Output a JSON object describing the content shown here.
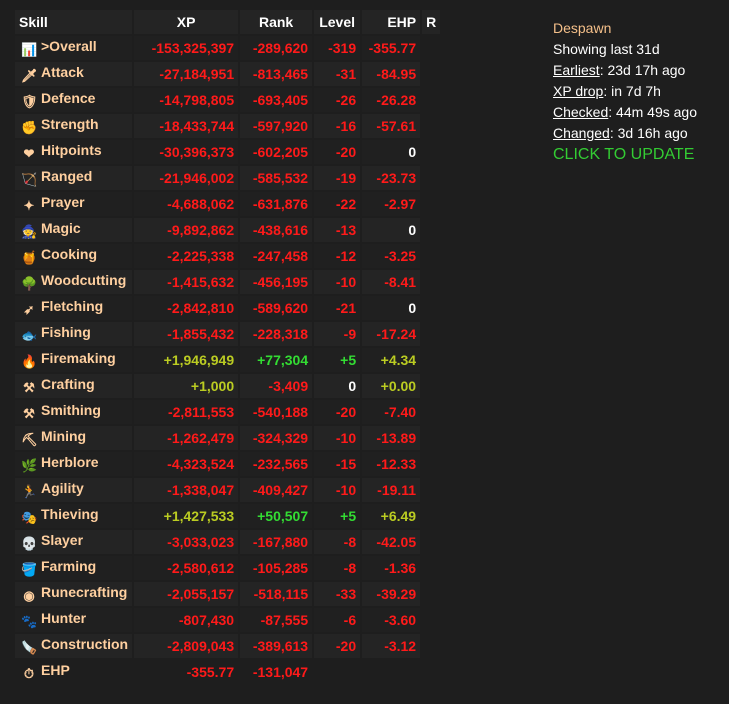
{
  "headers": {
    "skill": "Skill",
    "xp": "XP",
    "rank": "Rank",
    "level": "Level",
    "ehp": "EHP",
    "r": "R"
  },
  "rows": [
    {
      "skill": ">Overall",
      "icon": "overall-icon",
      "glyph": "📊",
      "xp": "-153,325,397",
      "xp_c": "neg",
      "rank": "-289,620",
      "rank_c": "neg",
      "level": "-319",
      "level_c": "neg",
      "ehp": "-355.77",
      "ehp_c": "neg"
    },
    {
      "skill": "Attack",
      "icon": "sword-icon",
      "glyph": "🗡",
      "xp": "-27,184,951",
      "xp_c": "neg",
      "rank": "-813,465",
      "rank_c": "neg",
      "level": "-31",
      "level_c": "neg",
      "ehp": "-84.95",
      "ehp_c": "neg"
    },
    {
      "skill": "Defence",
      "icon": "shield-icon",
      "glyph": "🛡",
      "xp": "-14,798,805",
      "xp_c": "neg",
      "rank": "-693,405",
      "rank_c": "neg",
      "level": "-26",
      "level_c": "neg",
      "ehp": "-26.28",
      "ehp_c": "neg"
    },
    {
      "skill": "Strength",
      "icon": "fist-icon",
      "glyph": "✊",
      "xp": "-18,433,744",
      "xp_c": "neg",
      "rank": "-597,920",
      "rank_c": "neg",
      "level": "-16",
      "level_c": "neg",
      "ehp": "-57.61",
      "ehp_c": "neg"
    },
    {
      "skill": "Hitpoints",
      "icon": "heart-icon",
      "glyph": "❤",
      "xp": "-30,396,373",
      "xp_c": "neg",
      "rank": "-602,205",
      "rank_c": "neg",
      "level": "-20",
      "level_c": "neg",
      "ehp": "0",
      "ehp_c": "zero"
    },
    {
      "skill": "Ranged",
      "icon": "bow-icon",
      "glyph": "🏹",
      "xp": "-21,946,002",
      "xp_c": "neg",
      "rank": "-585,532",
      "rank_c": "neg",
      "level": "-19",
      "level_c": "neg",
      "ehp": "-23.73",
      "ehp_c": "neg"
    },
    {
      "skill": "Prayer",
      "icon": "prayer-star-icon",
      "glyph": "✦",
      "xp": "-4,688,062",
      "xp_c": "neg",
      "rank": "-631,876",
      "rank_c": "neg",
      "level": "-22",
      "level_c": "neg",
      "ehp": "-2.97",
      "ehp_c": "neg"
    },
    {
      "skill": "Magic",
      "icon": "wizard-hat-icon",
      "glyph": "🧙",
      "xp": "-9,892,862",
      "xp_c": "neg",
      "rank": "-438,616",
      "rank_c": "neg",
      "level": "-13",
      "level_c": "neg",
      "ehp": "0",
      "ehp_c": "zero"
    },
    {
      "skill": "Cooking",
      "icon": "pot-icon",
      "glyph": "🍯",
      "xp": "-2,225,338",
      "xp_c": "neg",
      "rank": "-247,458",
      "rank_c": "neg",
      "level": "-12",
      "level_c": "neg",
      "ehp": "-3.25",
      "ehp_c": "neg"
    },
    {
      "skill": "Woodcutting",
      "icon": "tree-icon",
      "glyph": "🌳",
      "xp": "-1,415,632",
      "xp_c": "neg",
      "rank": "-456,195",
      "rank_c": "neg",
      "level": "-10",
      "level_c": "neg",
      "ehp": "-8.41",
      "ehp_c": "neg"
    },
    {
      "skill": "Fletching",
      "icon": "arrows-icon",
      "glyph": "➶",
      "xp": "-2,842,810",
      "xp_c": "neg",
      "rank": "-589,620",
      "rank_c": "neg",
      "level": "-21",
      "level_c": "neg",
      "ehp": "0",
      "ehp_c": "zero"
    },
    {
      "skill": "Fishing",
      "icon": "fish-icon",
      "glyph": "🐟",
      "xp": "-1,855,432",
      "xp_c": "neg",
      "rank": "-228,318",
      "rank_c": "neg",
      "level": "-9",
      "level_c": "neg",
      "ehp": "-17.24",
      "ehp_c": "neg"
    },
    {
      "skill": "Firemaking",
      "icon": "fire-icon",
      "glyph": "🔥",
      "xp": "+1,946,949",
      "xp_c": "posy",
      "rank": "+77,304",
      "rank_c": "pos",
      "level": "+5",
      "level_c": "pos",
      "ehp": "+4.34",
      "ehp_c": "posy"
    },
    {
      "skill": "Crafting",
      "icon": "chisel-icon",
      "glyph": "⚒",
      "xp": "+1,000",
      "xp_c": "posy",
      "rank": "-3,409",
      "rank_c": "neg",
      "level": "0",
      "level_c": "zero",
      "ehp": "+0.00",
      "ehp_c": "posy"
    },
    {
      "skill": "Smithing",
      "icon": "anvil-icon",
      "glyph": "⚒",
      "xp": "-2,811,553",
      "xp_c": "neg",
      "rank": "-540,188",
      "rank_c": "neg",
      "level": "-20",
      "level_c": "neg",
      "ehp": "-7.40",
      "ehp_c": "neg"
    },
    {
      "skill": "Mining",
      "icon": "pickaxe-icon",
      "glyph": "⛏",
      "xp": "-1,262,479",
      "xp_c": "neg",
      "rank": "-324,329",
      "rank_c": "neg",
      "level": "-10",
      "level_c": "neg",
      "ehp": "-13.89",
      "ehp_c": "neg"
    },
    {
      "skill": "Herblore",
      "icon": "herb-icon",
      "glyph": "🌿",
      "xp": "-4,323,524",
      "xp_c": "neg",
      "rank": "-232,565",
      "rank_c": "neg",
      "level": "-15",
      "level_c": "neg",
      "ehp": "-12.33",
      "ehp_c": "neg"
    },
    {
      "skill": "Agility",
      "icon": "runner-icon",
      "glyph": "🏃",
      "xp": "-1,338,047",
      "xp_c": "neg",
      "rank": "-409,427",
      "rank_c": "neg",
      "level": "-10",
      "level_c": "neg",
      "ehp": "-19.11",
      "ehp_c": "neg"
    },
    {
      "skill": "Thieving",
      "icon": "mask-icon",
      "glyph": "🎭",
      "xp": "+1,427,533",
      "xp_c": "posy",
      "rank": "+50,507",
      "rank_c": "pos",
      "level": "+5",
      "level_c": "pos",
      "ehp": "+6.49",
      "ehp_c": "posy"
    },
    {
      "skill": "Slayer",
      "icon": "skull-icon",
      "glyph": "💀",
      "xp": "-3,033,023",
      "xp_c": "neg",
      "rank": "-167,880",
      "rank_c": "neg",
      "level": "-8",
      "level_c": "neg",
      "ehp": "-42.05",
      "ehp_c": "neg"
    },
    {
      "skill": "Farming",
      "icon": "watering-can-icon",
      "glyph": "🪣",
      "xp": "-2,580,612",
      "xp_c": "neg",
      "rank": "-105,285",
      "rank_c": "neg",
      "level": "-8",
      "level_c": "neg",
      "ehp": "-1.36",
      "ehp_c": "neg"
    },
    {
      "skill": "Runecrafting",
      "icon": "rune-icon",
      "glyph": "◉",
      "xp": "-2,055,157",
      "xp_c": "neg",
      "rank": "-518,115",
      "rank_c": "neg",
      "level": "-33",
      "level_c": "neg",
      "ehp": "-39.29",
      "ehp_c": "neg"
    },
    {
      "skill": "Hunter",
      "icon": "paw-icon",
      "glyph": "🐾",
      "xp": "-807,430",
      "xp_c": "neg",
      "rank": "-87,555",
      "rank_c": "neg",
      "level": "-6",
      "level_c": "neg",
      "ehp": "-3.60",
      "ehp_c": "neg"
    },
    {
      "skill": "Construction",
      "icon": "saw-icon",
      "glyph": "🪚",
      "xp": "-2,809,043",
      "xp_c": "neg",
      "rank": "-389,613",
      "rank_c": "neg",
      "level": "-20",
      "level_c": "neg",
      "ehp": "-3.12",
      "ehp_c": "neg"
    }
  ],
  "ehp_row": {
    "skill": "EHP",
    "icon": "clock-icon",
    "glyph": "⏱",
    "xp": "-355.77",
    "rank": "-131,047"
  },
  "side": {
    "name": "Despawn",
    "showing": "Showing last 31d",
    "earliest_label": "Earliest",
    "earliest_value": ": 23d 17h ago",
    "xpdrop_label": "XP drop",
    "xpdrop_value": ": in 7d 7h",
    "checked_label": "Checked",
    "checked_value": ": 44m 49s ago",
    "changed_label": "Changed",
    "changed_value": ": 3d 16h ago",
    "update": "CLICK TO UPDATE"
  }
}
